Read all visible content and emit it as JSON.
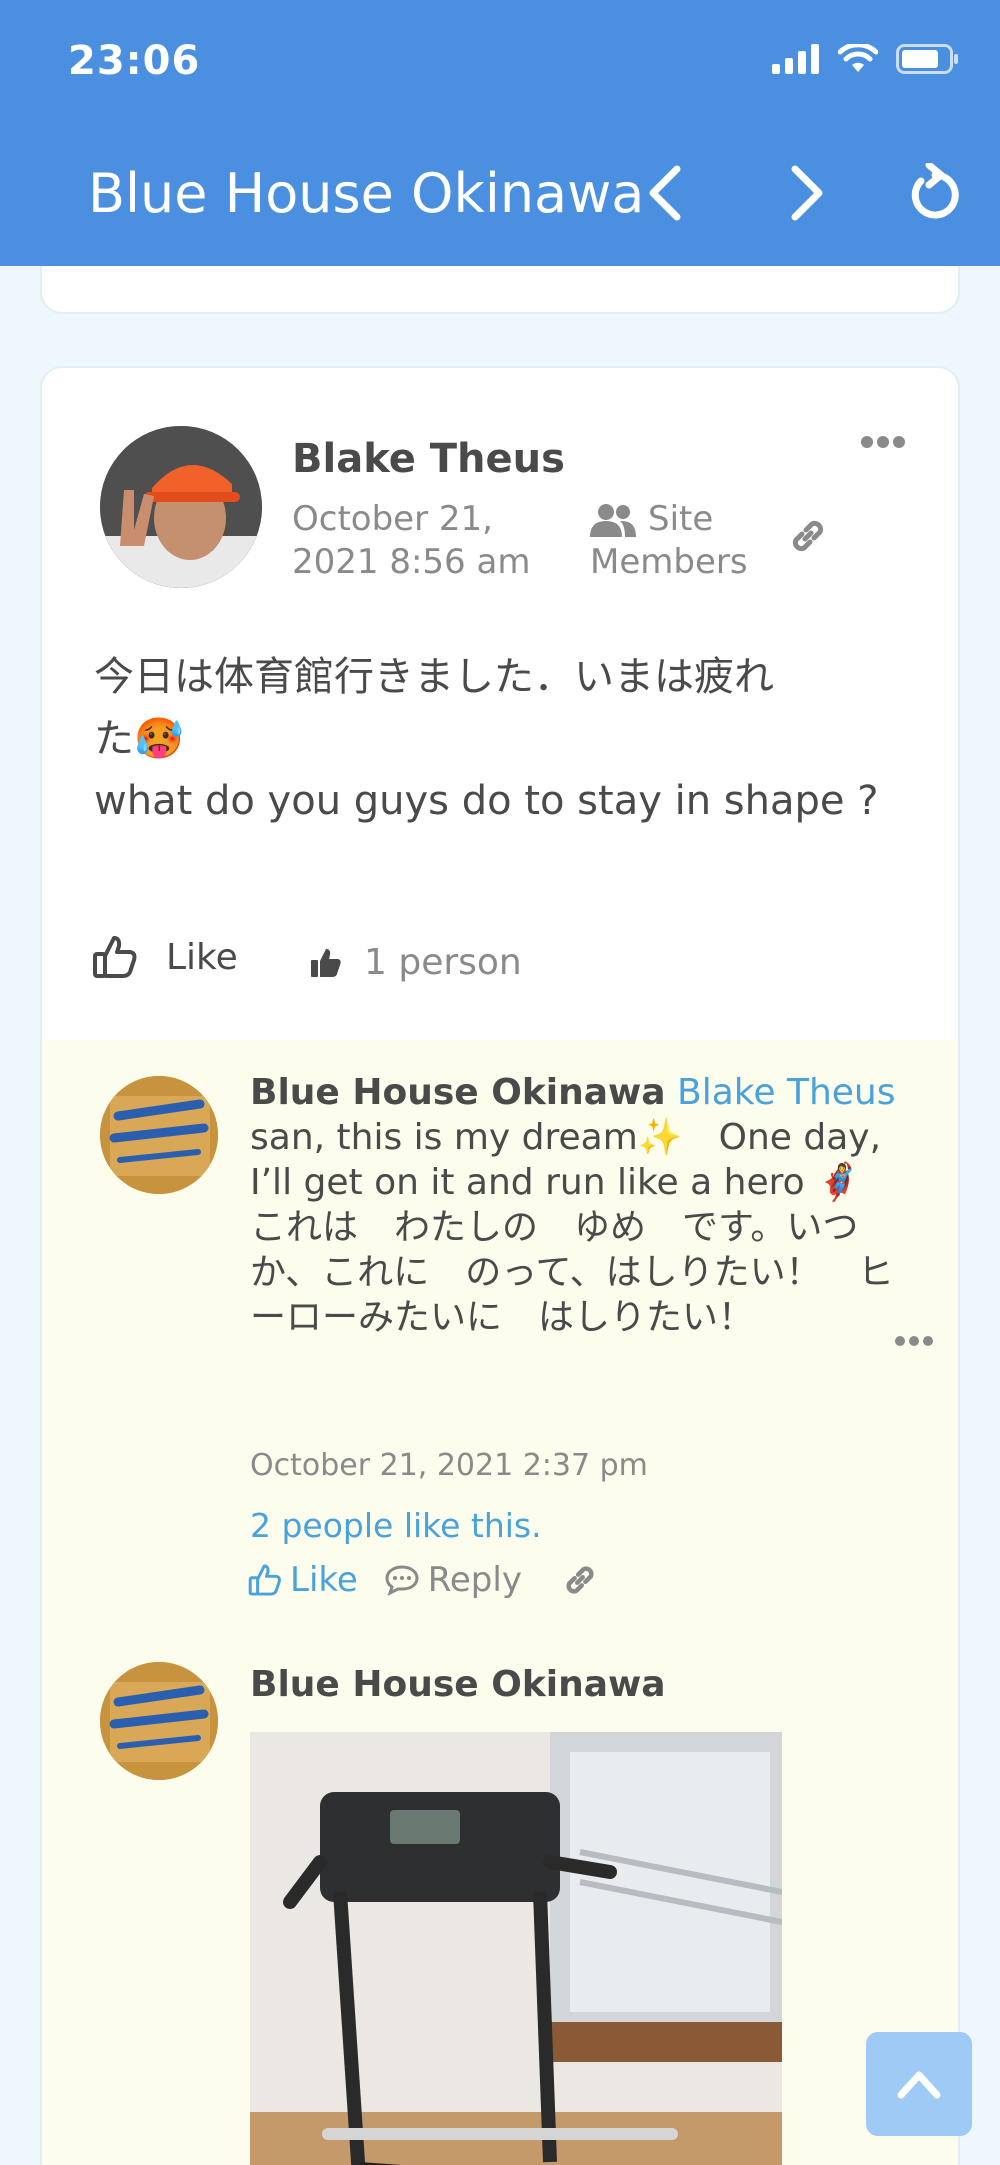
{
  "status": {
    "time": "23:06"
  },
  "header": {
    "title": "Blue House Okinawa"
  },
  "post": {
    "author": "Blake Theus",
    "date_line1": "October 21,",
    "date_line2": "2021 8:56 am",
    "visibility_line1": "Site",
    "visibility_line2": "Members",
    "text_line1": "今日は体育館行きました．いまは疲れ",
    "text_line2": "た🥵",
    "text_line3": "what do you guys do to stay in shape ?",
    "like_label": "Like",
    "like_count": "1 person"
  },
  "comments": [
    {
      "author": "Blue House Okinawa",
      "mention": "Blake Theus",
      "text_en": "san, this is my dream✨　One day, I’ll get on it and run like a hero 🦸‍♀️",
      "text_jp": "これは　わたしの　ゆめ　です。いつか、これに　のって、はしりたい！　ヒーローみたいに　はしりたい！",
      "date": "October 21, 2021 2:37 pm",
      "likes": "2 people like this.",
      "like_label": "Like",
      "reply_label": "Reply"
    },
    {
      "author": "Blue House Okinawa"
    }
  ],
  "colors": {
    "header": "#4a8fe0",
    "link": "#4aa2dc",
    "comment_bg": "#fcfdec"
  }
}
